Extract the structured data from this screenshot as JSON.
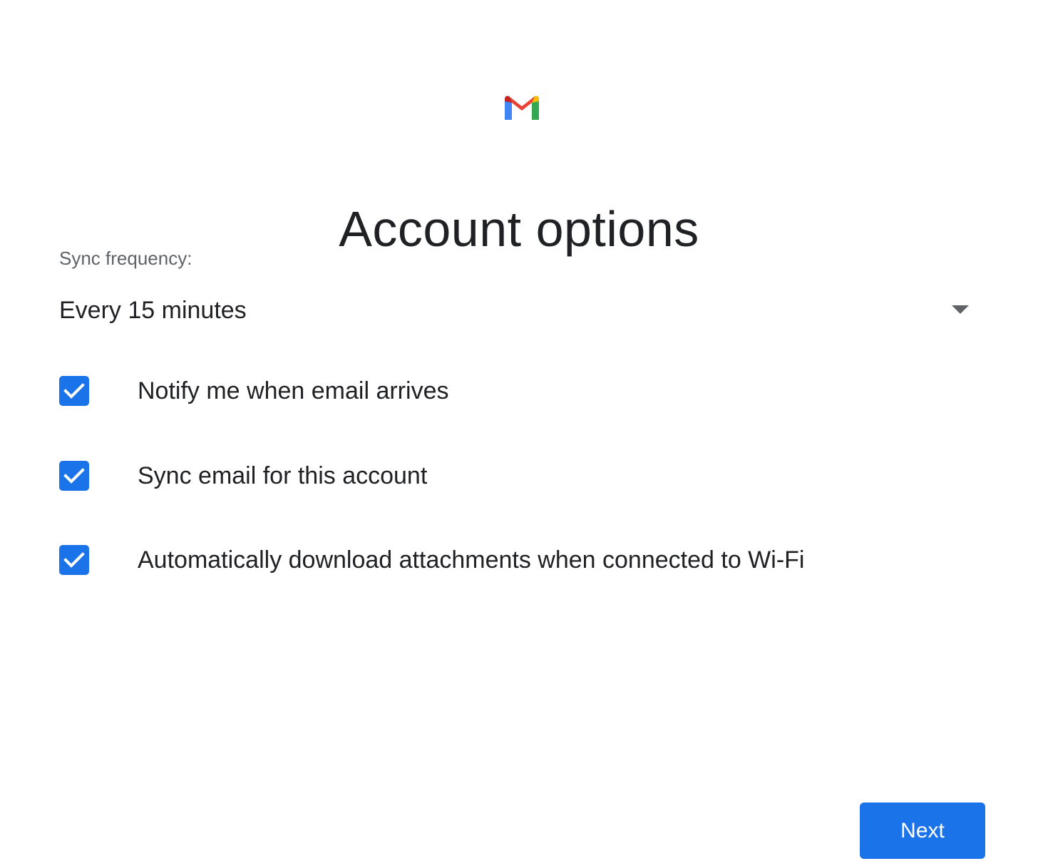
{
  "header": {
    "logo_icon": "gmail-logo-icon",
    "title": "Account options"
  },
  "sync": {
    "label": "Sync frequency:",
    "selected_value": "Every 15 minutes",
    "dropdown_icon": "dropdown-arrow-icon"
  },
  "options": [
    {
      "label": "Notify me when email arrives",
      "checked": true
    },
    {
      "label": "Sync email for this account",
      "checked": true
    },
    {
      "label": "Automatically download attachments when connected to Wi-Fi",
      "checked": true
    }
  ],
  "footer": {
    "next_label": "Next"
  },
  "colors": {
    "accent": "#1a73e8",
    "text_primary": "#202124",
    "text_secondary": "#5f6368",
    "gmail_red": "#ea4335",
    "gmail_blue": "#4285f4",
    "gmail_green": "#34a853",
    "gmail_yellow": "#fbbc04"
  }
}
